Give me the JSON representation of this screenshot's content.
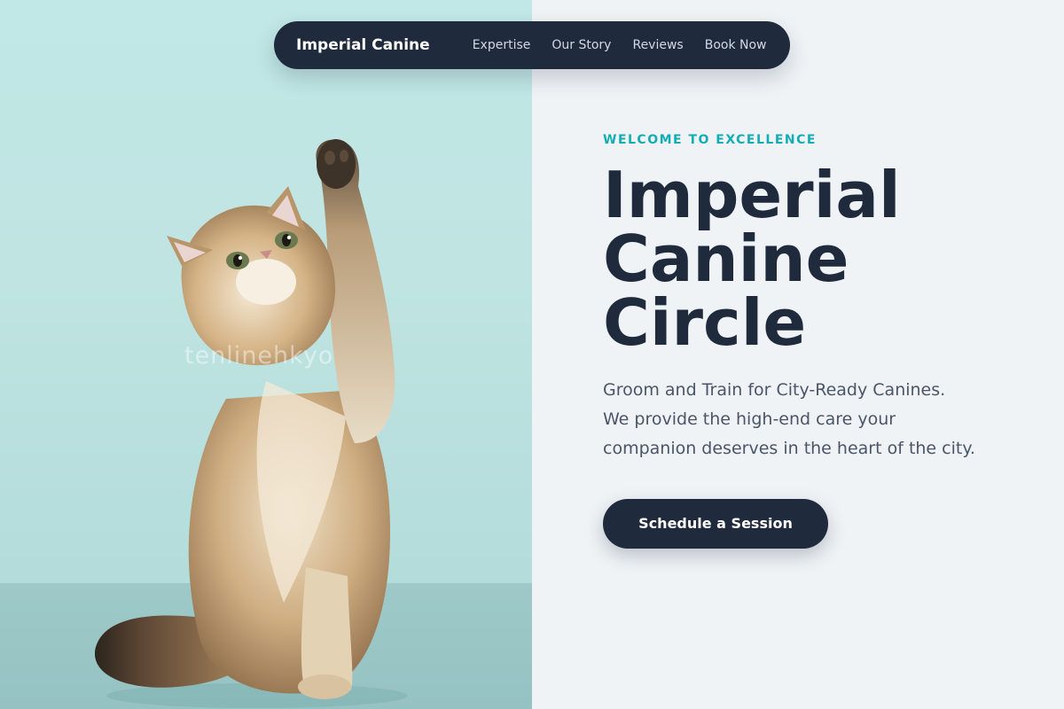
{
  "nav": {
    "brand": "Imperial Canine",
    "links": [
      "Expertise",
      "Our Story",
      "Reviews",
      "Book Now"
    ]
  },
  "hero": {
    "eyebrow": "WELCOME TO EXCELLENCE",
    "title_lines": [
      "Imperial",
      "Canine",
      "Circle"
    ],
    "description": "Groom and Train for City-Ready Canines. We provide the high-end care your companion deserves in the heart of the city.",
    "cta_label": "Schedule a Session",
    "image_watermark": "tenlinehkyo"
  },
  "colors": {
    "navy": "#1f2a3d",
    "accent_teal": "#14adb6",
    "page_background": "#eff3f6",
    "photo_backdrop": "#c1e7e6",
    "body_text": "#4b5567"
  }
}
